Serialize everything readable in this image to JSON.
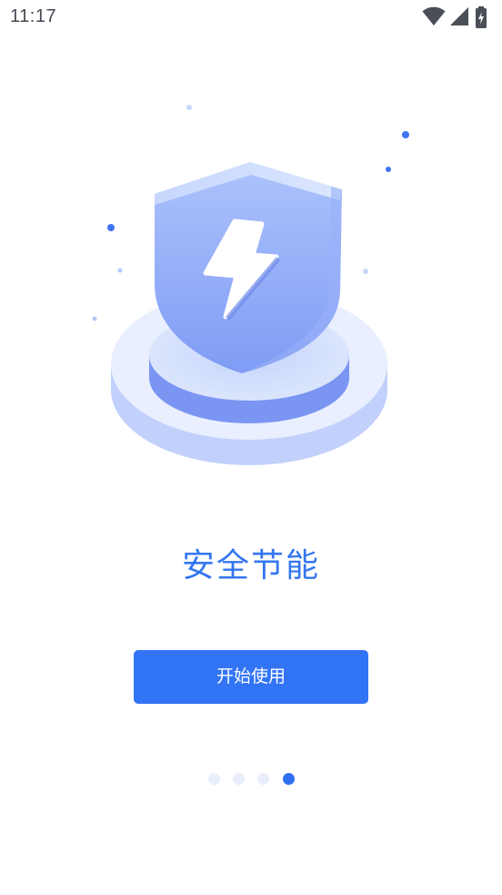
{
  "status_bar": {
    "time": "11:17",
    "icons": [
      "wifi-icon",
      "signal-icon",
      "battery-charging-icon"
    ]
  },
  "illustration": {
    "icon": "shield-lightning-icon"
  },
  "onboarding": {
    "title": "安全节能",
    "start_button_label": "开始使用",
    "page_count": 4,
    "current_page": 4
  },
  "colors": {
    "accent": "#3274f6",
    "title": "#3476f0",
    "dot_inactive": "#e8eefc",
    "dot_active": "#2f6ff2"
  }
}
